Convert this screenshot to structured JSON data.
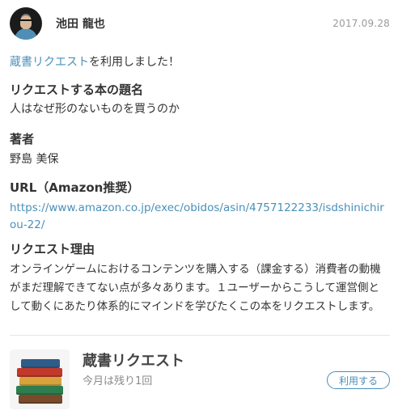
{
  "post": {
    "user_name": "池田 龍也",
    "date": "2017.09.28",
    "intro_link": "蔵書リクエスト",
    "intro_rest": "を利用しました！",
    "sections": {
      "title": {
        "heading": "リクエストする本の題名",
        "value": "人はなぜ形のないものを買うのか"
      },
      "author": {
        "heading": "著者",
        "value": "野島 美保"
      },
      "url": {
        "heading": "URL（Amazon推奨）",
        "value": "https://www.amazon.co.jp/exec/obidos/asin/4757122233/isdshinichirou-22/"
      },
      "reason": {
        "heading": "リクエスト理由",
        "value": "オンラインゲームにおけるコンテンツを購入する（課金する）消費者の動機がまだ理解できてない点が多々あります。１ユーザーからこうして運営側として動くにあたり体系的にマインドを学びたくこの本をリクエストします。"
      }
    }
  },
  "service": {
    "title": "蔵書リクエスト",
    "remaining": "今月は残り1回",
    "button_label": "利用する"
  },
  "icons": {
    "avatar": "user-avatar",
    "thumbnail": "book-stack-icon"
  },
  "colors": {
    "accent": "#4a90b8",
    "text": "#333333",
    "muted": "#9a9a9a"
  }
}
